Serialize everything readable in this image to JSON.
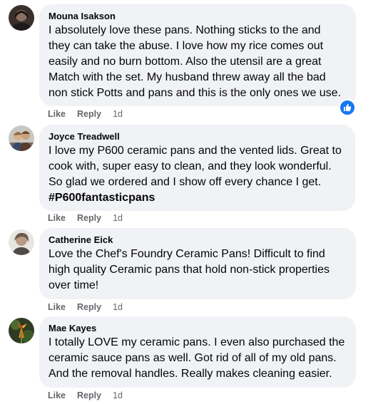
{
  "comments": [
    {
      "author": "Mouna Isakson",
      "text": "I absolutely love these pans. Nothing sticks to the and\nthey can take the abuse. I love how my rice comes out\neasily and no burn bottom. Also the utensil are a great\nMatch with the set. My husband threw away all the bad\nnon stick Potts and pans and this is the only ones we use.",
      "hashtag": "",
      "like_label": "Like",
      "reply_label": "Reply",
      "time": "1d",
      "reaction_icon": "thumbs-up-icon"
    },
    {
      "author": "Joyce Treadwell",
      "text": "I love my P600 ceramic pans and the vented lids. Great to\ncook with, super easy to clean, and they look wonderful.\nSo glad we ordered and I show off every chance I get.",
      "hashtag": "#P600fantasticpans",
      "like_label": "Like",
      "reply_label": "Reply",
      "time": "1d"
    },
    {
      "author": "Catherine Eick",
      "text": "Love the Chef's Foundry Ceramic Pans! Difficult to find\nhigh quality Ceramic pans that hold non-stick properties\nover time!",
      "hashtag": "",
      "like_label": "Like",
      "reply_label": "Reply",
      "time": "1d"
    },
    {
      "author": "Mae Kayes",
      "text": "I totally LOVE my ceramic pans. I even also purchased the\nceramic sauce pans as well. Got rid of all of my old pans.\nAnd the removal handles. Really makes cleaning easier.",
      "hashtag": "",
      "like_label": "Like",
      "reply_label": "Reply",
      "time": "1d"
    }
  ],
  "colors": {
    "bubble": "#f0f2f5",
    "secondary_text": "#65676b",
    "reaction_blue": "#1877f2"
  }
}
